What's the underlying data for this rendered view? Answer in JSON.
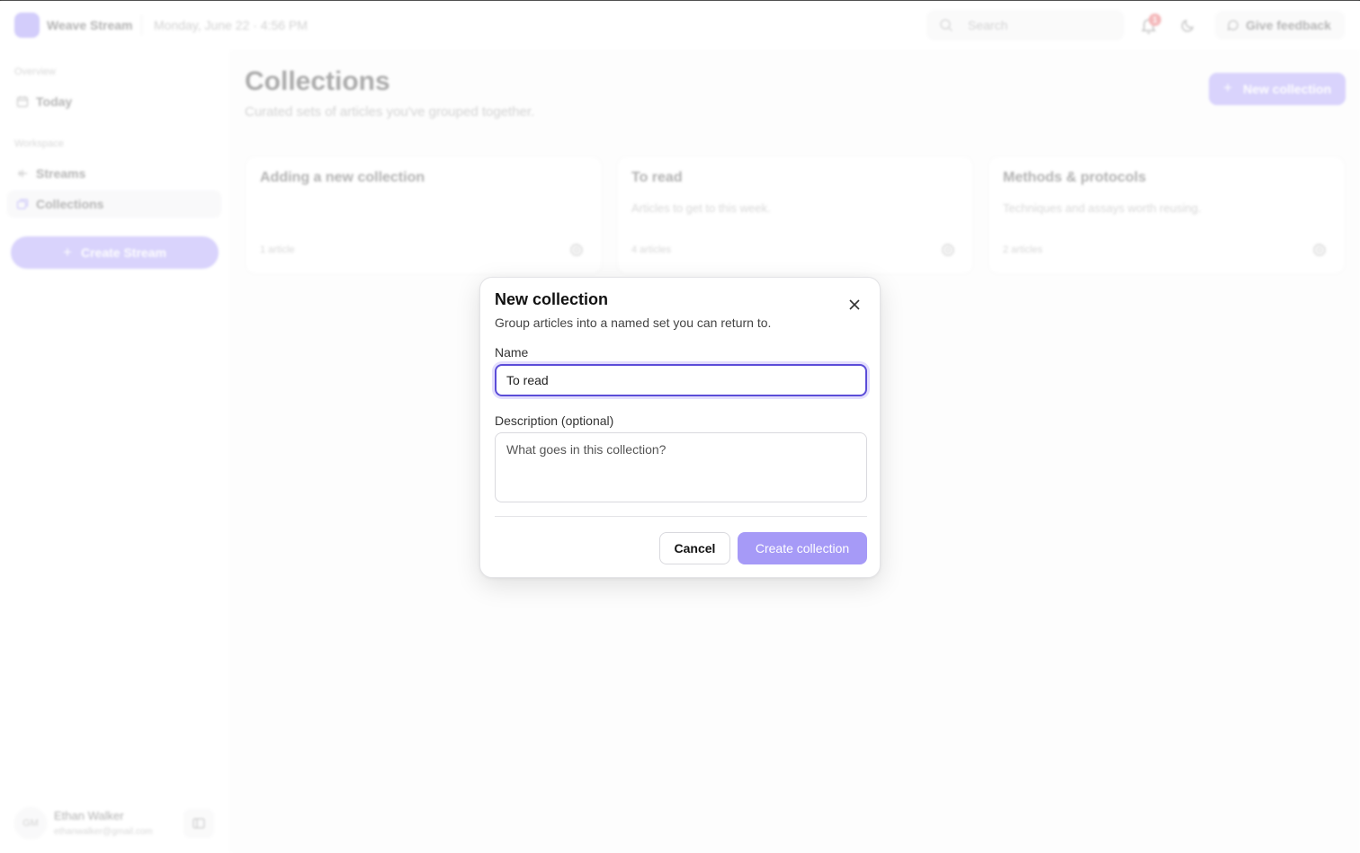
{
  "app": {
    "name": "Weave Stream",
    "datetime": "Monday, June 22 · 4:56 PM",
    "accent_color": "#8b7cf6"
  },
  "topbar": {
    "search_placeholder": "Search",
    "notification_count": "1",
    "feedback_label": "Give feedback"
  },
  "sidebar": {
    "overview_label": "Overview",
    "workspace_label": "Workspace",
    "items": [
      {
        "label": "Today",
        "icon": "calendar-icon"
      },
      {
        "label": "Streams",
        "icon": "streams-icon"
      },
      {
        "label": "Collections",
        "icon": "collections-icon",
        "active": true
      }
    ],
    "create_stream_label": "Create Stream",
    "user": {
      "initials": "GM",
      "name": "Ethan Walker",
      "email": "ethanwalker@gmail.com"
    }
  },
  "main": {
    "title": "Collections",
    "subtitle": "Curated sets of articles you've grouped together.",
    "new_collection_label": "New collection",
    "cards": [
      {
        "title": "Adding a new collection",
        "description": "",
        "count": "1 article"
      },
      {
        "title": "To read",
        "description": "Articles to get to this week.",
        "count": "4 articles"
      },
      {
        "title": "Methods & protocols",
        "description": "Techniques and assays worth reusing.",
        "count": "2 articles"
      }
    ]
  },
  "modal": {
    "title": "New collection",
    "description": "Group articles into a named set you can return to.",
    "name_label": "Name",
    "name_value": "To read",
    "description_label": "Description (optional)",
    "description_placeholder": "What goes in this collection?",
    "cancel_label": "Cancel",
    "create_label": "Create collection"
  }
}
